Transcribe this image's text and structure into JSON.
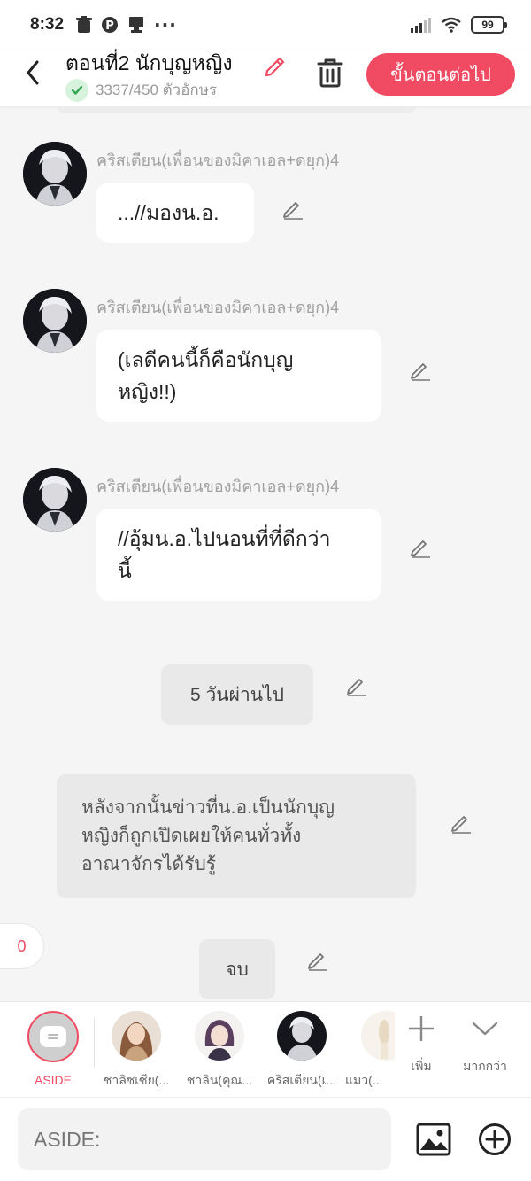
{
  "status": {
    "time": "8:32",
    "battery": "99"
  },
  "header": {
    "title": "ตอนที่2 นักบุญหญิง",
    "char_count": "3337/450 ตัวอักษร",
    "next_label": "ขั้นตอนต่อไป",
    "accent_color": "#f04b63"
  },
  "messages": [
    {
      "speaker": "คริสเตียน(เพื่อนของมิคาเอล+ดยุก)4",
      "text": "...//มองน.อ."
    },
    {
      "speaker": "คริสเตียน(เพื่อนของมิคาเอล+ดยุก)4",
      "text": "(เลดีคนนี้ก็คือนักบุญ\nหญิง!!)"
    },
    {
      "speaker": "คริสเตียน(เพื่อนของมิคาเอล+ดยุก)4",
      "text": "//อุ้มน.อ.ไปนอนที่ที่ดีกว่า\nนี้"
    }
  ],
  "time_skip": "5 วันผ่านไป",
  "narration": "หลังจากนั้นข่าวที่น.อ.เป็นนักบุญ\nหญิงก็ถูกเปิดเผยให้คนทั่วทั้ง\nอาณาจักรได้รับรู้",
  "end_label": "จบ",
  "counter": "0",
  "characters": [
    {
      "label": "ASIDE"
    },
    {
      "label": "ชาลิซเซีย(..."
    },
    {
      "label": "ชาลิน(คุณ..."
    },
    {
      "label": "คริสเตียน(เ..."
    },
    {
      "label": "แมว(..."
    }
  ],
  "tools": {
    "add_label": "เพิ่ม",
    "more_label": "มากกว่า"
  },
  "input": {
    "placeholder": "ASIDE:"
  }
}
